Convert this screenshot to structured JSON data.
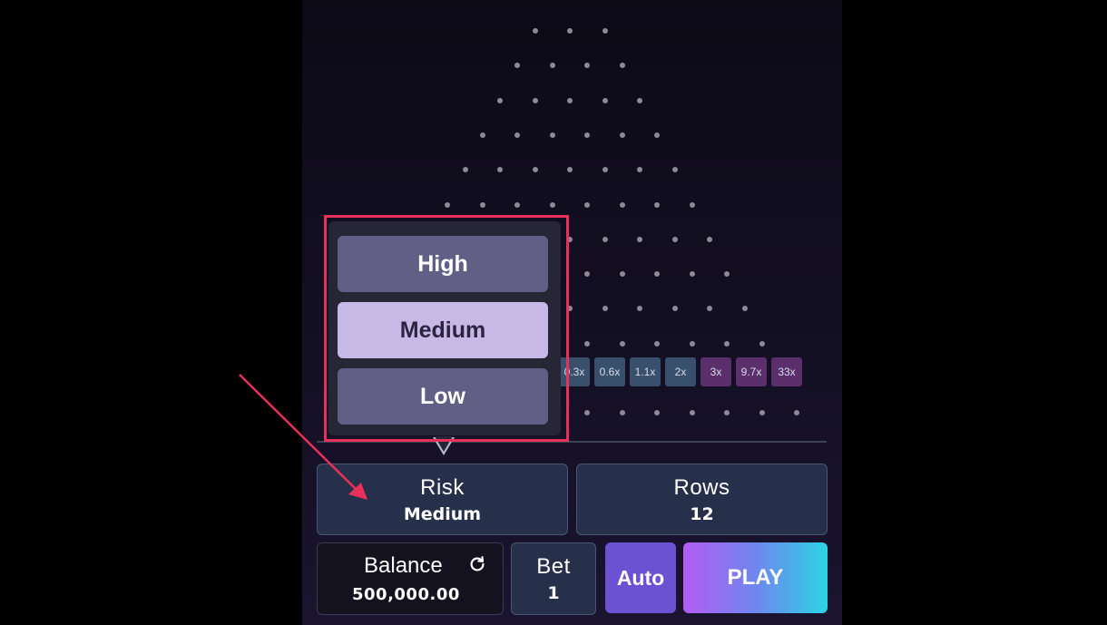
{
  "board": {
    "rows": 12,
    "buckets_visible": [
      {
        "label": "0.3x",
        "tier": "blue"
      },
      {
        "label": "0.6x",
        "tier": "blue"
      },
      {
        "label": "1.1x",
        "tier": "blue"
      },
      {
        "label": "2x",
        "tier": "blue"
      },
      {
        "label": "3x",
        "tier": "purple"
      },
      {
        "label": "9.7x",
        "tier": "purple"
      },
      {
        "label": "33x",
        "tier": "purple"
      }
    ]
  },
  "risk_dropdown": {
    "options": [
      "High",
      "Medium",
      "Low"
    ],
    "selected": "Medium"
  },
  "risk": {
    "label": "Risk",
    "value": "Medium"
  },
  "rows_control": {
    "label": "Rows",
    "value": "12"
  },
  "balance": {
    "label": "Balance",
    "value": "500,000.00"
  },
  "bet": {
    "label": "Bet",
    "value": "1"
  },
  "auto_label": "Auto",
  "play_label": "PLAY",
  "colors": {
    "highlight": "#e8305a",
    "play_gradient_start": "#b35cf4",
    "play_gradient_end": "#2cd4e6",
    "auto_bg": "#6a52d2",
    "selected_option": "#c8b8e6"
  }
}
